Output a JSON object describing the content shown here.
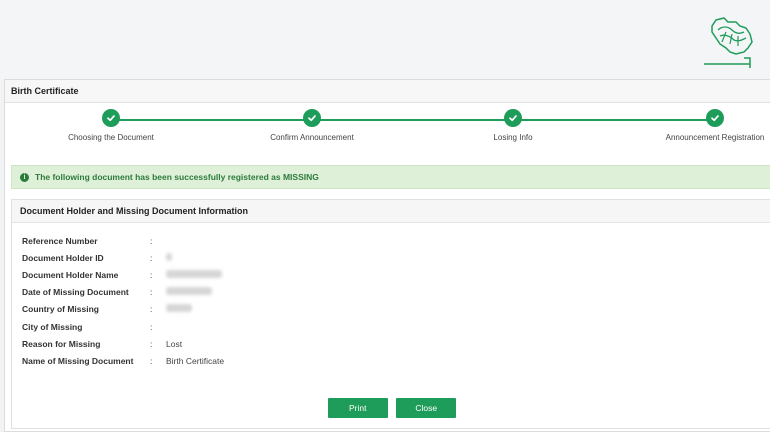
{
  "page": {
    "title": "Birth Certificate"
  },
  "steps": [
    {
      "label": "Choosing the Document",
      "state": "complete"
    },
    {
      "label": "Confirm Announcement",
      "state": "complete"
    },
    {
      "label": "Losing Info",
      "state": "complete"
    },
    {
      "label": "Announcement Registration",
      "state": "complete"
    }
  ],
  "alert": {
    "text": "The following document has been successfully registered as MISSING",
    "icon": "info-circle-icon"
  },
  "info": {
    "title": "Document Holder and Missing Document Information",
    "rows": [
      {
        "label": "Reference Number",
        "value": ""
      },
      {
        "label": "Document Holder ID",
        "value": ""
      },
      {
        "label": "Document Holder Name",
        "value": ""
      },
      {
        "label": "Date of Missing Document",
        "value": ""
      },
      {
        "label": "Country of Missing",
        "value": ""
      },
      {
        "label": "City of Missing",
        "value": ""
      },
      {
        "label": "Reason for Missing",
        "value": "Lost"
      },
      {
        "label": "Name of Missing Document",
        "value": "Birth Certificate"
      }
    ]
  },
  "buttons": {
    "print": "Print",
    "close": "Close"
  },
  "colors": {
    "accent": "#1e9c5a",
    "alert_bg": "#dff0d8",
    "alert_text": "#2c7a3c"
  }
}
